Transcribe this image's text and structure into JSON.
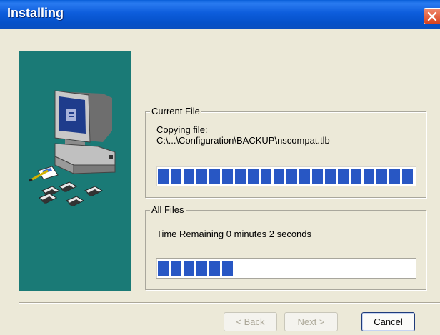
{
  "window": {
    "title": "Installing"
  },
  "icons": {
    "close": "close-icon",
    "illustration": "computer-install-illustration"
  },
  "colors": {
    "side_panel": "#1a7a76",
    "progress_fill": "#2857c4",
    "titlebar": "#0d5ddc"
  },
  "current_file": {
    "legend": "Current File",
    "line1": "Copying file:",
    "line2": "C:\\...\\Configuration\\BACKUP\\nscompat.tlb",
    "progress": 1.0
  },
  "all_files": {
    "legend": "All Files",
    "status": "Time Remaining 0 minutes 2 seconds",
    "progress": 0.35
  },
  "buttons": {
    "back": "< Back",
    "next": "Next >",
    "cancel": "Cancel"
  }
}
